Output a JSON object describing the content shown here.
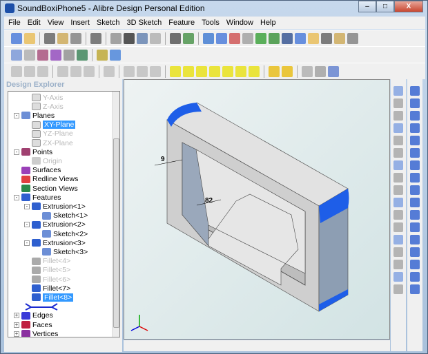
{
  "window": {
    "title": "SoundBoxiPhone5 - Alibre Design Personal Edition",
    "minimize": "–",
    "maximize": "□",
    "close": "X"
  },
  "menu": [
    "File",
    "Edit",
    "View",
    "Insert",
    "Sketch",
    "3D Sketch",
    "Feature",
    "Tools",
    "Window",
    "Help"
  ],
  "explorer": {
    "title": "Design Explorer",
    "items": [
      {
        "label": "Y-Axis",
        "level": 2,
        "dim": true,
        "icon": "axis-icon"
      },
      {
        "label": "Z-Axis",
        "level": 2,
        "dim": true,
        "icon": "axis-icon"
      },
      {
        "label": "Planes",
        "level": 1,
        "toggle": "-",
        "icon": "planes-icon"
      },
      {
        "label": "XY-Plane",
        "level": 2,
        "selected": true,
        "icon": "plane-icon"
      },
      {
        "label": "YZ-Plane",
        "level": 2,
        "dim": true,
        "icon": "plane-icon"
      },
      {
        "label": "ZX-Plane",
        "level": 2,
        "dim": true,
        "icon": "plane-icon"
      },
      {
        "label": "Points",
        "level": 1,
        "toggle": "-",
        "icon": "points-icon"
      },
      {
        "label": "Origin",
        "level": 2,
        "dim": true,
        "icon": "origin-icon"
      },
      {
        "label": "Surfaces",
        "level": 1,
        "icon": "surfaces-icon"
      },
      {
        "label": "Redline Views",
        "level": 1,
        "icon": "redline-icon"
      },
      {
        "label": "Section Views",
        "level": 1,
        "icon": "section-icon"
      },
      {
        "label": "Features",
        "level": 1,
        "toggle": "-",
        "icon": "features-icon"
      },
      {
        "label": "Extrusion<1>",
        "level": 2,
        "toggle": "-",
        "icon": "extrusion-icon"
      },
      {
        "label": "Sketch<1>",
        "level": 3,
        "icon": "sketch-icon"
      },
      {
        "label": "Extrusion<2>",
        "level": 2,
        "toggle": "-",
        "icon": "extrusion-icon"
      },
      {
        "label": "Sketch<2>",
        "level": 3,
        "icon": "sketch-icon"
      },
      {
        "label": "Extrusion<3>",
        "level": 2,
        "toggle": "-",
        "icon": "extrusion-icon"
      },
      {
        "label": "Sketch<3>",
        "level": 3,
        "icon": "sketch-icon"
      },
      {
        "label": "Fillet<4>",
        "level": 2,
        "dim": true,
        "icon": "fillet-icon"
      },
      {
        "label": "Fillet<5>",
        "level": 2,
        "dim": true,
        "icon": "fillet-icon"
      },
      {
        "label": "Fillet<6>",
        "level": 2,
        "dim": true,
        "icon": "fillet-icon"
      },
      {
        "label": "Fillet<7>",
        "level": 2,
        "icon": "fillet-icon"
      },
      {
        "label": "Fillet<8>",
        "level": 2,
        "selected": true,
        "icon": "fillet-icon"
      },
      {
        "label": "",
        "level": 2,
        "rollback": true,
        "icon": "rollback-bar-icon"
      },
      {
        "label": "Edges",
        "level": 1,
        "toggle": "+",
        "icon": "edges-icon"
      },
      {
        "label": "Faces",
        "level": 1,
        "toggle": "+",
        "icon": "faces-icon"
      },
      {
        "label": "Vertices",
        "level": 1,
        "toggle": "+",
        "icon": "vertices-icon"
      }
    ]
  },
  "viewport": {
    "dim1": "9",
    "dim2": "82"
  },
  "colors": {
    "accent": "#3399ff",
    "model_face": "#c9c9c9",
    "model_side": "#8d9eb3",
    "fillet_highlight": "#1e5ee8"
  }
}
